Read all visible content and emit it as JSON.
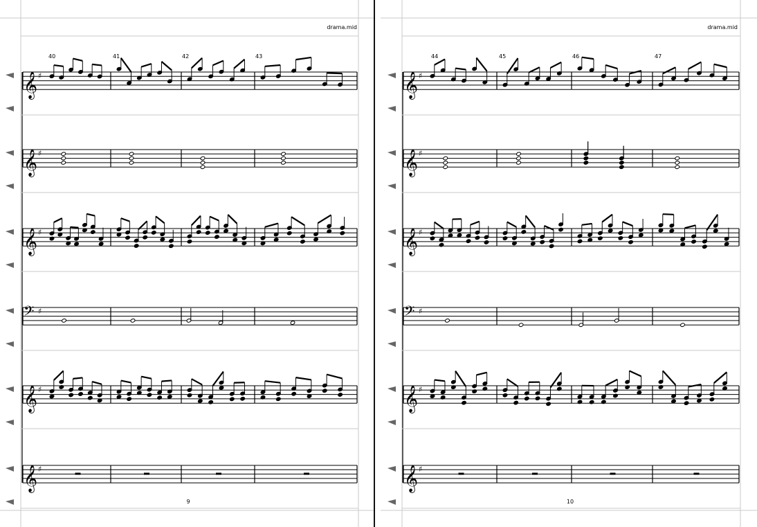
{
  "pages": [
    {
      "filename": "drama.mid",
      "page_number": "9",
      "measures": [
        "40",
        "41",
        "42",
        "43"
      ],
      "staves": [
        {
          "clef": "treble"
        },
        {
          "clef": "treble"
        },
        {
          "clef": "treble"
        },
        {
          "clef": "bass"
        },
        {
          "clef": "treble"
        },
        {
          "clef": "treble"
        }
      ]
    },
    {
      "filename": "drama.mid",
      "page_number": "10",
      "measures": [
        "44",
        "45",
        "46",
        "47"
      ],
      "staves": [
        {
          "clef": "treble"
        },
        {
          "clef": "treble"
        },
        {
          "clef": "treble"
        },
        {
          "clef": "bass"
        },
        {
          "clef": "treble"
        },
        {
          "clef": "treble"
        }
      ]
    }
  ],
  "icons": {
    "staff_marker": "triangle-marker-icon",
    "treble_clef": "treble-clef-icon",
    "bass_clef": "bass-clef-icon",
    "key_signature": "sharp-icon"
  },
  "colors": {
    "ink": "#000000",
    "marker": "#666666",
    "guide": "#c8c8c8",
    "ghost": "#9fb4d6"
  }
}
